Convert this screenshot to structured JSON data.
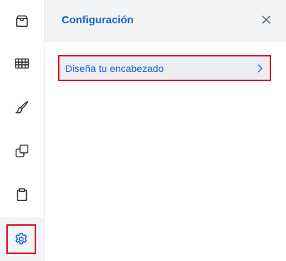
{
  "sidebar": {
    "items": [
      {
        "icon": "box-icon",
        "active": false
      },
      {
        "icon": "grid-icon",
        "active": false
      },
      {
        "icon": "brush-icon",
        "active": false
      },
      {
        "icon": "copy-icon",
        "active": false
      },
      {
        "icon": "clipboard-icon",
        "active": false
      },
      {
        "icon": "gear-icon",
        "active": true
      }
    ]
  },
  "panel": {
    "title": "Configuración",
    "close_icon": "close-icon",
    "items": [
      {
        "label": "Diseña tu encabezado",
        "icon": "chevron-right-icon"
      }
    ]
  },
  "colors": {
    "accent": "#1b5fd0",
    "highlight": "#e0001b",
    "icon": "#2b2f36"
  }
}
